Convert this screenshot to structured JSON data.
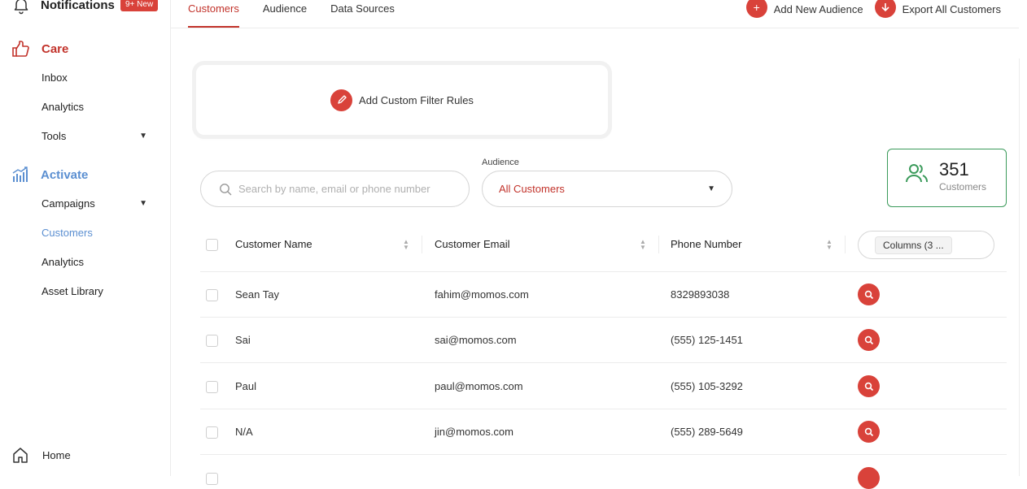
{
  "sidebar": {
    "notifications": {
      "label": "Notifications",
      "badge": "9+ New"
    },
    "care": {
      "label": "Care",
      "items": [
        "Inbox",
        "Analytics",
        "Tools"
      ]
    },
    "activate": {
      "label": "Activate",
      "items": [
        "Campaigns",
        "Customers",
        "Analytics",
        "Asset Library"
      ],
      "active": "Customers"
    },
    "home": "Home"
  },
  "tabs": {
    "items": [
      "Customers",
      "Audience",
      "Data Sources"
    ],
    "active": "Customers"
  },
  "actions": {
    "add_audience": "Add New Audience",
    "export": "Export All Customers"
  },
  "filter": {
    "label": "Add Custom Filter Rules"
  },
  "search": {
    "placeholder": "Search by name, email or phone number"
  },
  "audience": {
    "label": "Audience",
    "value": "All Customers"
  },
  "customer_count": {
    "value": "351",
    "label": "Customers"
  },
  "table": {
    "headers": [
      "Customer Name",
      "Customer Email",
      "Phone Number"
    ],
    "columns_button": "Columns (3 ...",
    "rows": [
      {
        "name": "Sean Tay",
        "email": "fahim@momos.com",
        "phone": "8329893038"
      },
      {
        "name": "Sai",
        "email": "sai@momos.com",
        "phone": "(555) 125-1451"
      },
      {
        "name": "Paul",
        "email": "paul@momos.com",
        "phone": "(555) 105-3292"
      },
      {
        "name": "N/A",
        "email": "jin@momos.com",
        "phone": "(555) 289-5649"
      }
    ]
  },
  "colors": {
    "accent": "#d9423a",
    "activate_blue": "#5b8fd1",
    "count_green": "#3a9a5a"
  },
  "icons": [
    "bell-icon",
    "care-icon",
    "activate-icon",
    "home-icon",
    "plus-icon",
    "download-icon",
    "pencil-icon",
    "search-icon",
    "users-icon",
    "sort-icon",
    "view-icon",
    "chevron-down-icon"
  ]
}
